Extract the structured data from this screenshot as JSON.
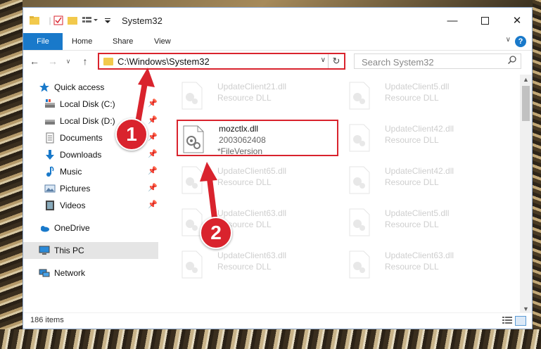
{
  "window": {
    "title": "System32"
  },
  "ribbon": {
    "tabs": [
      "File",
      "Home",
      "Share",
      "View"
    ],
    "help": "?"
  },
  "address": {
    "path": "C:\\Windows\\System32"
  },
  "search": {
    "placeholder": "Search System32"
  },
  "sidebar": {
    "items": [
      {
        "label": "Quick access",
        "icon": "star-icon",
        "pinned": false
      },
      {
        "label": "Local Disk (C:)",
        "icon": "drive-icon",
        "pinned": true
      },
      {
        "label": "Local Disk (D:)",
        "icon": "drive-icon",
        "pinned": true
      },
      {
        "label": "Documents",
        "icon": "documents-icon",
        "pinned": true
      },
      {
        "label": "Downloads",
        "icon": "download-icon",
        "pinned": true
      },
      {
        "label": "Music",
        "icon": "music-icon",
        "pinned": true
      },
      {
        "label": "Pictures",
        "icon": "pictures-icon",
        "pinned": true
      },
      {
        "label": "Videos",
        "icon": "videos-icon",
        "pinned": true
      },
      {
        "label": "OneDrive",
        "icon": "cloud-icon",
        "pinned": false
      },
      {
        "label": "This PC",
        "icon": "monitor-icon",
        "pinned": false,
        "selected": true
      },
      {
        "label": "Network",
        "icon": "network-icon",
        "pinned": false
      }
    ]
  },
  "files": {
    "left": [
      {
        "name": "UpdateClient21.dll",
        "type": "Resource DLL"
      },
      {
        "name": "mozctlx.dll",
        "type": "2003062408",
        "extra": "*FileVersion",
        "highlighted": true
      },
      {
        "name": "UpdateClient65.dll",
        "type": "Resource DLL"
      },
      {
        "name": "UpdateClient63.dll",
        "type": "Resource DLL"
      },
      {
        "name": "UpdateClient63.dll",
        "type": "Resource DLL"
      }
    ],
    "right": [
      {
        "name": "UpdateClient5.dll",
        "type": "Resource DLL"
      },
      {
        "name": "UpdateClient42.dll",
        "type": "Resource DLL"
      },
      {
        "name": "UpdateClient42.dll",
        "type": "Resource DLL"
      },
      {
        "name": "UpdateClient5.dll",
        "type": "Resource DLL"
      },
      {
        "name": "UpdateClient63.dll",
        "type": "Resource DLL"
      }
    ]
  },
  "status": {
    "count": "186 items"
  },
  "callouts": [
    "1",
    "2"
  ],
  "colors": {
    "accent": "#1979ca",
    "highlight": "#d9232d"
  }
}
